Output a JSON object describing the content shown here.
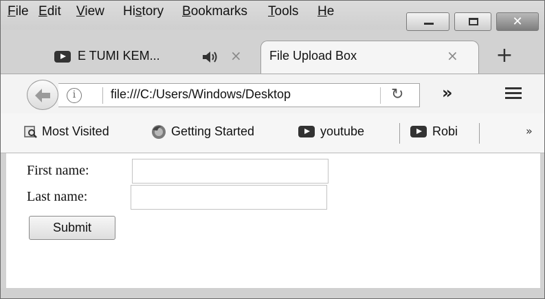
{
  "menubar": {
    "items": [
      {
        "label": "File",
        "accel": "F",
        "rest": "ile"
      },
      {
        "label": "Edit",
        "accel": "E",
        "rest": "dit"
      },
      {
        "label": "View",
        "accel": "V",
        "rest": "iew"
      },
      {
        "label": "History",
        "pre": "Hi",
        "accel": "s",
        "rest": "tory"
      },
      {
        "label": "Bookmarks",
        "accel": "B",
        "rest": "ookmarks"
      },
      {
        "label": "Tools",
        "accel": "T",
        "rest": "ools"
      },
      {
        "label": "He",
        "accel": "H",
        "rest": "e"
      }
    ]
  },
  "window_controls": {
    "minimize_icon": "minimize-icon",
    "maximize_icon": "maximize-icon",
    "close_glyph": "✕"
  },
  "tabs": [
    {
      "title": "E TUMI KEM...",
      "icon": "youtube-icon",
      "audio_icon": "speaker-icon",
      "close": "×",
      "active": false
    },
    {
      "title": "File Upload Box",
      "close": "×",
      "active": true
    }
  ],
  "new_tab": "+",
  "navbar": {
    "back_icon": "back-arrow-icon",
    "info_glyph": "i",
    "url": "file:///C:/Users/Windows/Desktop",
    "reload_glyph": "↻",
    "overflow_glyph": "»",
    "menu_icon": "hamburger-menu-icon"
  },
  "bookmarks": {
    "items": [
      {
        "label": "Most Visited",
        "icon": "most-visited-icon"
      },
      {
        "label": "Getting Started",
        "icon": "firefox-icon"
      },
      {
        "label": "youtube",
        "icon": "youtube-icon"
      },
      {
        "label": "Robi",
        "icon": "youtube-icon"
      }
    ],
    "overflow_glyph": "»"
  },
  "form": {
    "first_name_label": "First name:",
    "first_name_value": "",
    "last_name_label": "Last name:",
    "last_name_value": "",
    "submit_label": "Submit"
  },
  "colors": {
    "chrome": "#d2d2d2",
    "tab_active": "#f5f5f5",
    "content_bg": "#ffffff"
  }
}
